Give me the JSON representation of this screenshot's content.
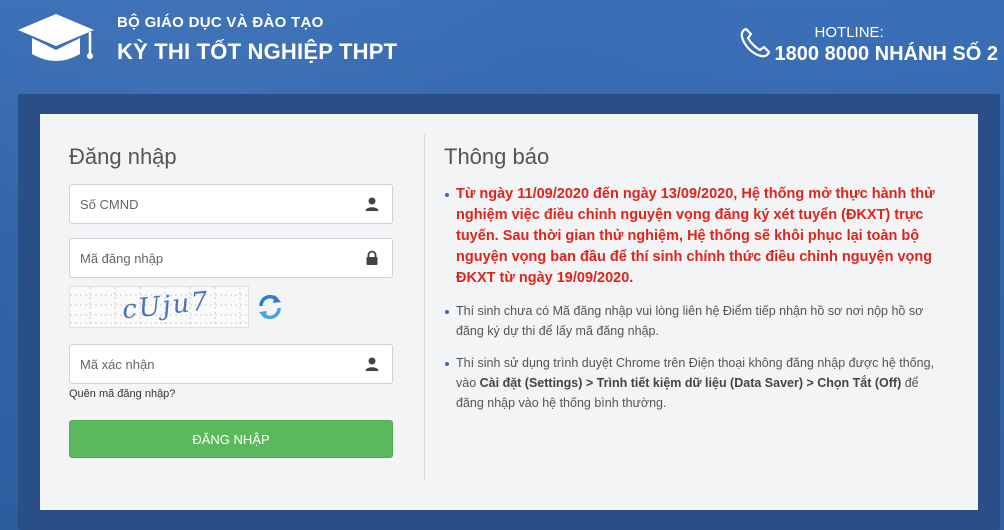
{
  "header": {
    "org_line1": "BỘ GIÁO DỤC VÀ ĐÀO TẠO",
    "org_line2": "KỲ THI TỐT NGHIỆP THPT",
    "hotline_label": "HOTLINE:",
    "hotline_number": "1800 8000 NHÁNH SỐ 2"
  },
  "login": {
    "title": "Đăng nhập",
    "id_placeholder": "Số CMND",
    "code_placeholder": "Mã đăng nhập",
    "captcha_text": "cUju7",
    "captcha_placeholder": "Mã xác nhận",
    "forgot_link": "Quên mã đăng nhập?",
    "submit_label": "ĐĂNG NHẬP"
  },
  "notice": {
    "title": "Thông báo",
    "items": [
      "Từ ngày 11/09/2020 đến ngày 13/09/2020, Hệ thống mở thực hành thử nghiệm việc điều chỉnh nguyện vọng đăng ký xét tuyển (ĐKXT) trực tuyến. Sau thời gian thử nghiệm, Hệ thống sẽ khôi phục lại toàn bộ nguyện vọng ban đầu để thí sinh chính thức điều chỉnh nguyện vọng ĐKXT từ ngày 19/09/2020.",
      "Thí sinh chưa có Mã đăng nhập vui lòng liên hệ Điểm tiếp nhận hồ sơ nơi nộp hồ sơ đăng ký dự thi để lấy mã đăng nhập."
    ],
    "item3": {
      "prefix": "Thí sinh sử dụng trình duyệt Chrome trên Điện thoại không đăng nhập được hệ thống, vào ",
      "bold": "Cài đặt (Settings) > Trình tiết kiệm dữ liệu (Data Saver) > Chọn Tắt (Off)",
      "suffix": " để đăng nhập vào hệ thống bình thường."
    }
  },
  "colors": {
    "background": "#2f62a8",
    "button": "#5cb85c",
    "alert_text": "#e2231a"
  },
  "icons": {
    "logo": "graduation-cap-icon",
    "phone": "phone-icon",
    "user": "user-icon",
    "lock": "lock-icon",
    "refresh": "refresh-icon"
  }
}
